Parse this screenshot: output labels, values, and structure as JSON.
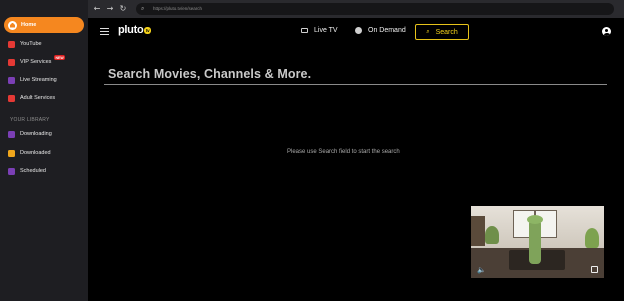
{
  "sidebar": {
    "items": [
      {
        "label": "Home",
        "icon": "home-icon",
        "color": "#f5871f",
        "active": true
      },
      {
        "label": "YouTube",
        "icon": "youtube-icon",
        "color": "#e53935"
      },
      {
        "label": "VIP Services",
        "icon": "vip-icon",
        "color": "#e53935",
        "badge": "NEW"
      },
      {
        "label": "Live Streaming",
        "icon": "live-streaming-icon",
        "color": "#7b3fb5"
      },
      {
        "label": "Adult Services",
        "icon": "adult-services-icon",
        "color": "#e53935"
      }
    ],
    "library_heading": "YOUR LIBRARY",
    "library_items": [
      {
        "label": "Downloading",
        "icon": "downloading-icon",
        "color": "#7b3fb5"
      },
      {
        "label": "Downloaded",
        "icon": "downloaded-icon",
        "color": "#f0a61c"
      },
      {
        "label": "Scheduled",
        "icon": "scheduled-icon",
        "color": "#7b3fb5"
      }
    ]
  },
  "browser": {
    "url": "https://pluto.tv/en/search"
  },
  "header": {
    "logo": "pluto",
    "logo_badge": "tv",
    "live_tv_label": "Live TV",
    "on_demand_label": "On Demand",
    "search_label": "Search",
    "accent_color": "#f5d21a"
  },
  "main": {
    "search_heading": "Search Movies, Channels & More.",
    "hint": "Please use Search field to start the search"
  }
}
